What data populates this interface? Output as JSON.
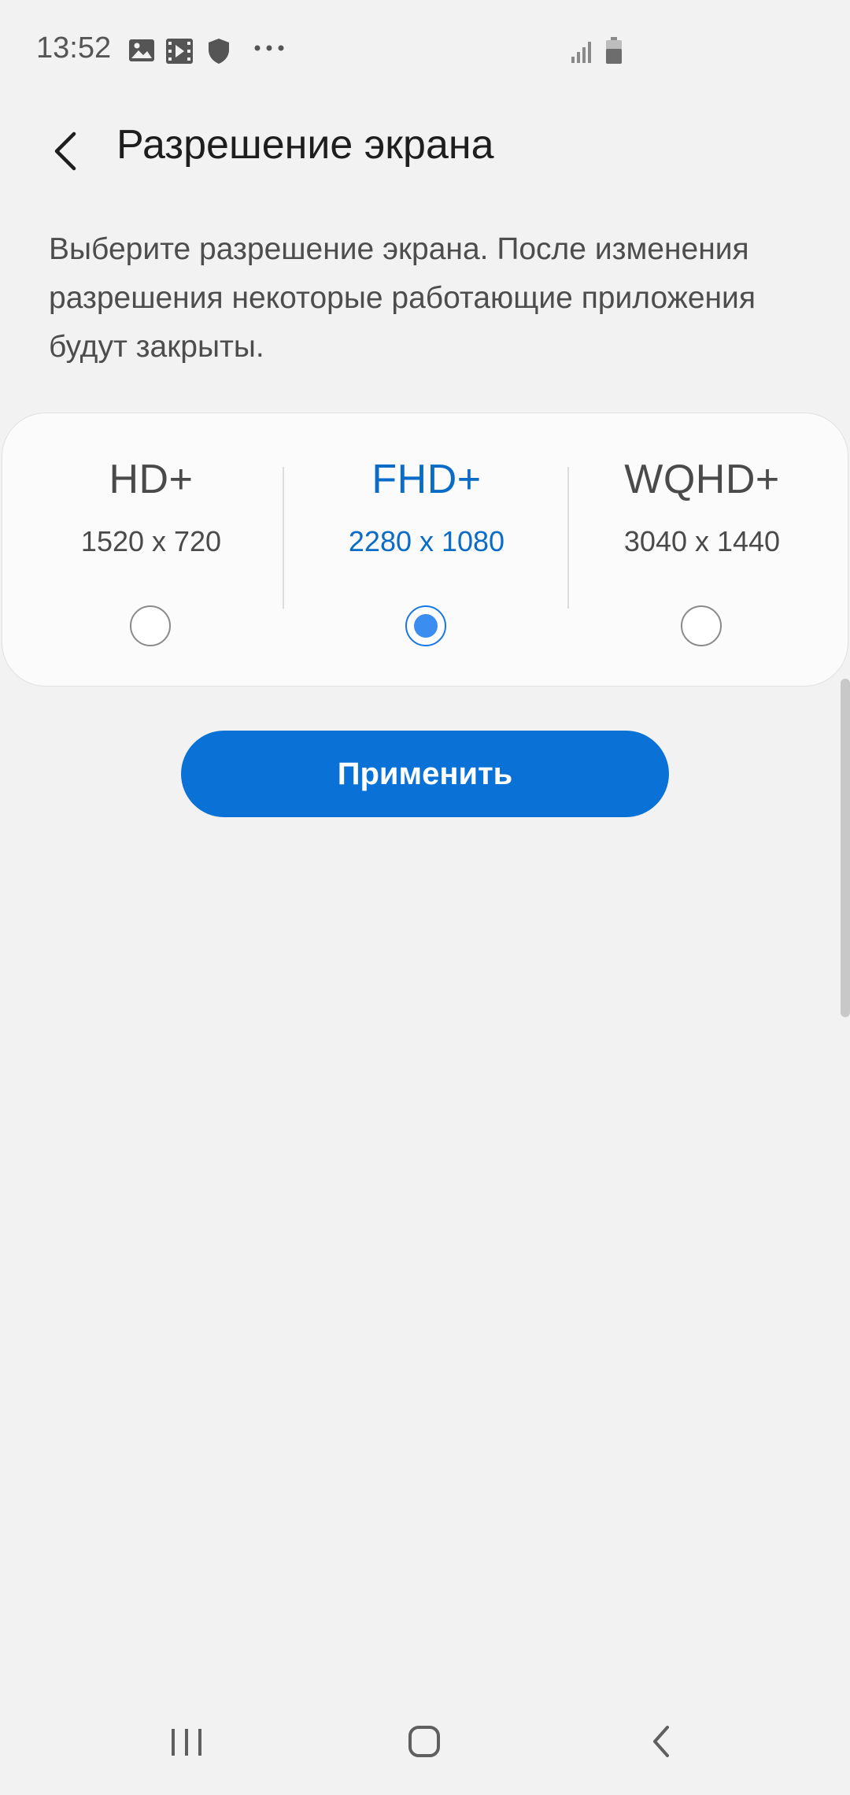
{
  "status_bar": {
    "time": "13:52",
    "icons": [
      "gallery-icon",
      "video-icon",
      "shield-icon",
      "more-icon",
      "signal-icon",
      "battery-icon"
    ]
  },
  "header": {
    "title": "Разрешение экрана",
    "back_icon": "chevron-left-icon"
  },
  "description": "Выберите разрешение экрана. После изменения разрешения некоторые работающие приложения будут закрыты.",
  "resolutions": [
    {
      "name": "HD+",
      "size": "1520 x 720",
      "selected": false
    },
    {
      "name": "FHD+",
      "size": "2280 x 1080",
      "selected": true
    },
    {
      "name": "WQHD+",
      "size": "3040 x 1440",
      "selected": false
    }
  ],
  "apply_label": "Применить",
  "navigation": {
    "icons": [
      "recents-icon",
      "home-icon",
      "back-icon"
    ]
  },
  "colors": {
    "accent": "#0a72d6",
    "selected_text": "#0a6cc7",
    "background": "#f2f2f2",
    "card": "#fbfbfb"
  }
}
